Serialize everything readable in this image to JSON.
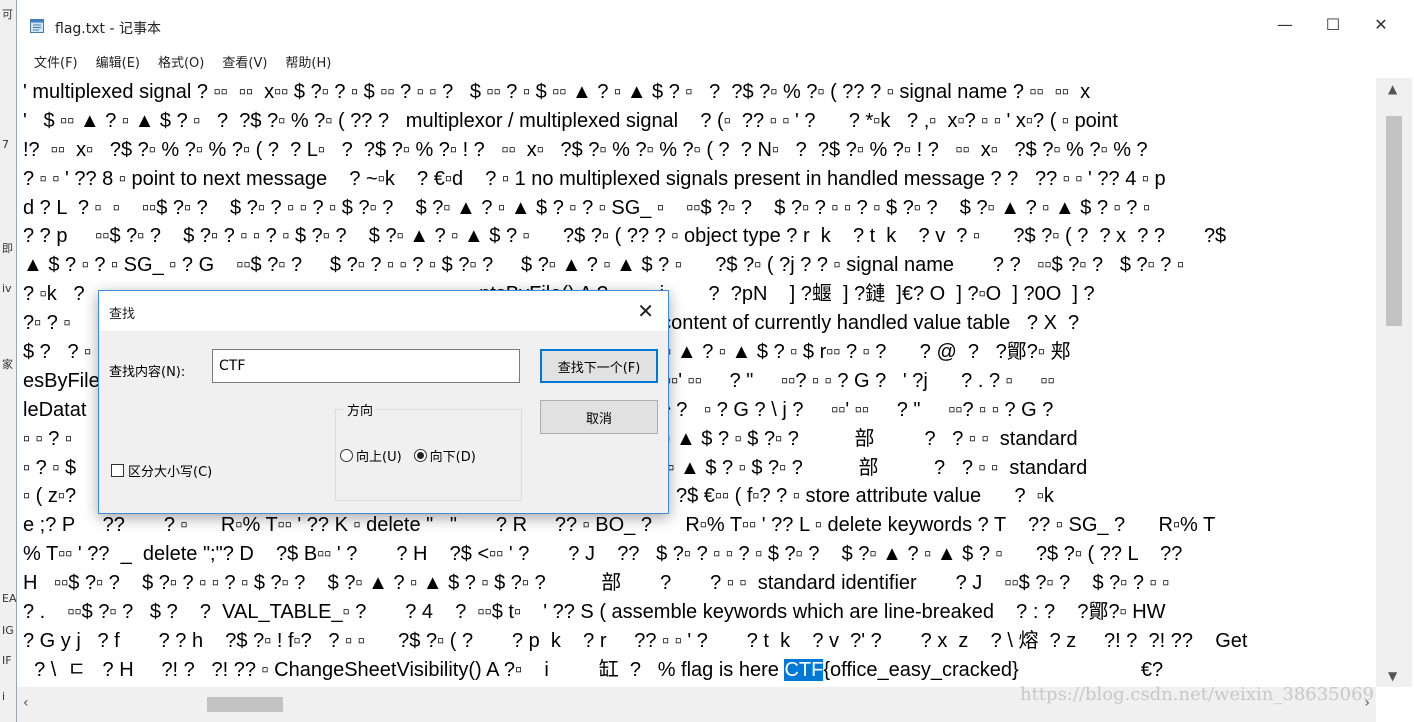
{
  "desktop": {
    "glyphs": [
      "可",
      "7",
      "即",
      "iv",
      "家",
      "EA",
      "IG",
      "IF",
      "i"
    ]
  },
  "window": {
    "title": "flag.txt - 记事本",
    "icon": "notepad-icon",
    "minimize": "—",
    "maximize": "☐",
    "close": "✕"
  },
  "menu": {
    "items": [
      "文件(F)",
      "编辑(E)",
      "格式(O)",
      "查看(V)",
      "帮助(H)"
    ]
  },
  "editor": {
    "lines": [
      "' multiplexed signal ? ▫▫  ▫▫  x▫▫ $ ?▫ ? ▫ $ ▫▫ ? ▫ ▫ ?   $ ▫▫ ? ▫ $ ▫▫ ▲ ? ▫ ▲ $ ? ▫   ?  ?$ ?▫ % ?▫ ( ?? ? ▫ signal name ? ▫▫  ▫▫  x",
      "'   $ ▫▫ ▲ ? ▫ ▲ $ ? ▫   ?  ?$ ?▫ % ?▫ ( ?? ?   multiplexor / multiplexed signal    ? (▫  ?? ▫ ▫ ' ?      ? *▫k   ? ,▫  x▫? ▫ ▫ ' x▫? ( ▫ point",
      "!?  ▫▫  x▫   ?$ ?▫ % ?▫ % ?▫ ( ?  ? L▫   ?  ?$ ?▫ % ?▫ ! ?   ▫▫  x▫   ?$ ?▫ % ?▫ % ?▫ ( ?  ? N▫   ?  ?$ ?▫ % ?▫ ! ?   ▫▫  x▫   ?$ ?▫ % ?▫ % ?",
      "? ▫ ▫ ' ?? 8 ▫ point to next message    ? ~▫k    ? €▫d    ? ▫ 1 no multiplexed signals present in handled message ? ?   ?? ▫ ▫ ' ?? 4 ▫ p",
      "d ? L  ? ▫  ▫    ▫▫$ ?▫ ?    $ ?▫ ? ▫ ▫ ? ▫ $ ?▫ ?    $ ?▫ ▲ ? ▫ ▲ $ ? ▫ ? ▫ SG_ ▫    ▫▫$ ?▫ ?    $ ?▫ ? ▫ ▫ ? ▫ $ ?▫ ?    $ ?▫ ▲ ? ▫ ▲ $ ? ▫ ? ▫",
      "? ? p     ▫▫$ ?▫ ?    $ ?▫ ? ▫ ▫ ? ▫ $ ?▫ ?    $ ?▫ ▲ ? ▫ ▲ $ ? ▫      ?$ ?▫ ( ?? ? ▫ object type ? r  k    ? t  k    ? v  ? ▫      ?$ ?▫ ( ?  ? x  ? ?       ?$",
      "▲ $ ? ▫ ? ▫ SG_ ▫ ? G    ▫▫$ ?▫ ?     $ ?▫ ? ▫ ▫ ? ▫ $ ?▫ ?     $ ?▫ ▲ ? ▫ ▲ $ ? ▫      ?$ ?▫ ( ?j ? ? ▫ signal name       ? ?   ▫▫$ ?▫ ?   $ ?▫ ? ▫",
      "? ▫k   ?                                                                       ntsByFile() A ?▫        i        ?  ?pN    ] ?蝘  ] ?鏈  ]€? O  ] ?▫O  ] ?0O  ] ?",
      "?▫ ? ▫                                                                          ame        ? ▫ /  store content of currently handled value table   ? X  ?",
      "$ ?   ? ▫                                                                        ? ▫ ▫ ? ▫ $ ?▫ ?    $ ?▫ ▲ ? ▫ ▲ $ ? ▫ $ r▫▫ ? ▫ ?      ? @  ?   ?鄮?▫ 郏",
      "esByFile                                                                       ^ ?   ▫ ? G ? \\ j ?     ▫▫' ▫▫     ? \"     ▫▫? ▫ ▫ ? G ?   ' ?j      ? . ? ▫     ▫▫",
      "leDatat                                                                        桯  ] ?瘰  ? ▫     !    ! ^ ?   ▫ ? G ? \\ j ?     ▫▫' ▫▫     ? \"     ▫▫? ▫ ▫ ? G ?",
      "▫ ▫ ? ▫                                                                         ? ▫ $ ?▫ ?    $ ?▫ ▲ ? ▫ ▲ $ ? ▫ $ ?▫ ?          部         ?   ? ▫ ▫  standard",
      "▫ ? ▫ $                                                                         ? ▫ $ ?▫ ?    $ ?▫ ▲ ? ▫ ▲ $ ? ▫ $ ?▫ ?          部          ?   ? ▫ ▫  standard",
      "▫ ( z▫?                                                                         $ ?▫ ▲ ? ▫ ▲ $ ? ▫      ?$ €▫▫ ( f▫? ? ▫ store attribute value      ?  ▫k",
      "e ;? P     ??       ? ▫      R▫% T▫▫ ' ?? K ▫ delete \"   \"       ? R     ?? ▫ BO_ ?      R▫% T▫▫ ' ?? L ▫ delete keywords ? T    ?? ▫ SG_ ?      R▫% T",
      "% T▫▫ ' ??  _  delete \";\"? D    ?$ B▫▫ ' ?       ? H    ?$ <▫▫ ' ?       ? J    ??   $ ?▫ ? ▫ ▫ ? ▫ $ ?▫ ?    $ ?▫ ▲ ? ▫ ▲ $ ? ▫      ?$ ?▫ ( ?? L    ??",
      "H   ▫▫$ ?▫ ?    $ ?▫ ? ▫ ▫ ? ▫ $ ?▫ ?    $ ?▫ ▲ ? ▫ ▲ $ ? ▫ $ ?▫ ?          部       ?       ? ▫ ▫  standard identifier       ? J    ▫▫$ ?▫ ?    $ ?▫ ? ▫ ▫",
      "? .    ▫▫$ ?▫ ?   $ ?    ?  VAL_TABLE_▫ ?       ? 4    ?  ▫▫$ t▫    ' ?? S ( assemble keywords which are line-breaked    ? : ?    ?鄮?▫ HW",
      "? G y j   ? f       ? ? h    ?$ ?▫ ! f▫?   ? ▫ ▫      ?$ ?▫ ( ?       ? p  k    ? r     ?? ▫ ▫ ' ?       ? t  k    ? v  ?' ?       ? x  z    ? \\ 熔  ? z     ?! ?  ?! ??    Get",
      "  ? \\  ㄷ   ? H     ?! ?   ?! ?? ▫ ChangeSheetVisibility() A ?▫    i         缸  ?   % flag is here "
    ],
    "highlight": "CTF",
    "after_highlight": "{office_easy_cracked}                      €?"
  },
  "find_dialog": {
    "title": "查找",
    "close": "✕",
    "label": "查找内容(N):",
    "value": "CTF",
    "find_next": "查找下一个(F)",
    "cancel": "取消",
    "direction_label": "方向",
    "up_label": "向上(U)",
    "down_label": "向下(D)",
    "match_case_label": "区分大小写(C)"
  },
  "scrollbar": {
    "up": "▲",
    "down": "▼",
    "left": "‹",
    "right": "›"
  },
  "watermark": "https://blog.csdn.net/weixin_38635069"
}
